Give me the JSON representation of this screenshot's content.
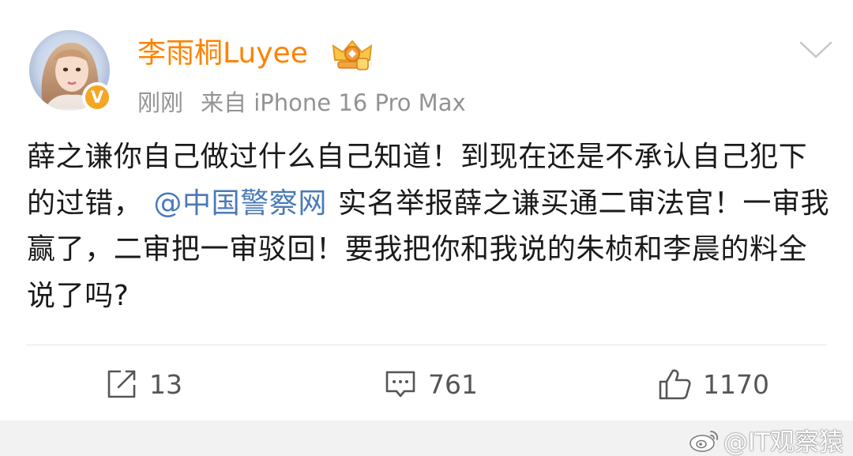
{
  "post": {
    "author": {
      "name": "李雨桐Luyee",
      "verified_badge": "V",
      "crown_icon": "crown-badge-icon",
      "avatar_icon": "avatar-photo"
    },
    "time": "刚刚",
    "source": "来自 iPhone 16 Pro Max",
    "text_before_mention": "薛之谦你自己做过什么自己知道！到现在还是不承认自己犯下的过错，",
    "mention": "@中国警察网",
    "text_after_mention": "实名举报薛之谦买通二审法官！一审我赢了，二审把一审驳回！要我把你和我说的朱桢和李晨的料全说了吗?"
  },
  "actions": {
    "repost_count": "13",
    "comment_count": "761",
    "like_count": "1170"
  },
  "watermark": {
    "text": "@IT观察猿",
    "icon": "weibo-logo-icon"
  },
  "colors": {
    "username": "#ff8200",
    "meta": "#939393",
    "mention": "#4a7ab7",
    "text": "#1a1a1a",
    "verified": "#f5a623"
  }
}
